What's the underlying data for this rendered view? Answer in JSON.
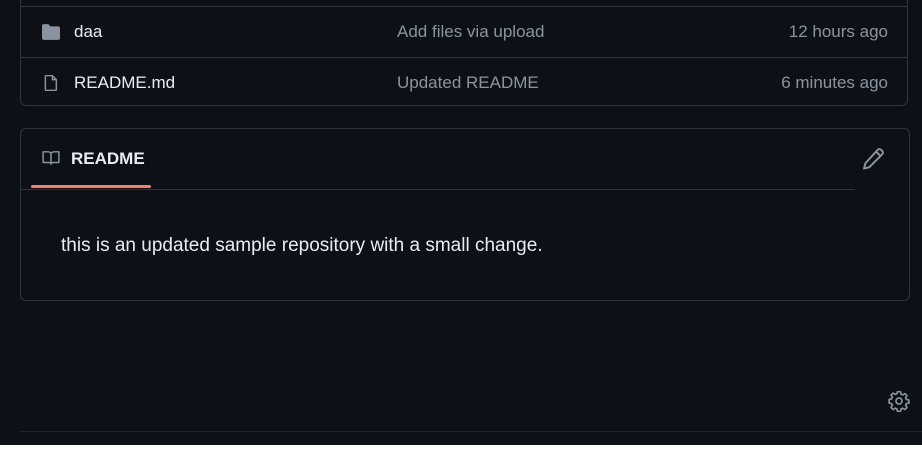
{
  "files": [
    {
      "type": "folder",
      "icon": "folder-icon",
      "name": "daa",
      "commit_message": "Add files via upload",
      "time": "12 hours ago"
    },
    {
      "type": "file",
      "icon": "file-icon",
      "name": "README.md",
      "commit_message": "Updated README",
      "time": "6 minutes ago"
    }
  ],
  "readme": {
    "tab_icon": "book-icon",
    "tab_label": "README",
    "edit_icon": "pencil-icon",
    "content": "this is an updated sample repository with a small change."
  },
  "footer": {
    "settings_icon": "gear-icon"
  },
  "colors": {
    "background": "#0d1117",
    "border": "#30363d",
    "text_primary": "#e6edf3",
    "text_muted": "#8b949e",
    "tab_underline": "#f78166",
    "icon_muted": "#8b949e"
  }
}
